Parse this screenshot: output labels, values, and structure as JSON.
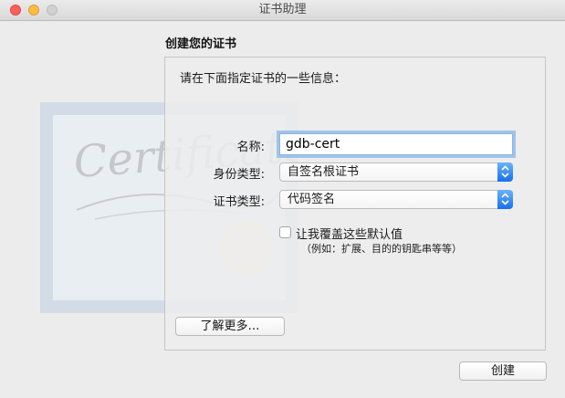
{
  "window": {
    "title": "证书助理"
  },
  "page": {
    "heading": "创建您的证书",
    "instruction": "请在下面指定证书的一些信息：",
    "artwork_text": "Certificate"
  },
  "form": {
    "name_label": "名称:",
    "name_value": "gdb-cert",
    "identity_type_label": "身份类型:",
    "identity_type_value": "自签名根证书",
    "cert_type_label": "证书类型:",
    "cert_type_value": "代码签名",
    "override_label": "让我覆盖这些默认值",
    "override_hint": "（例如：扩展、目的的钥匙串等等）",
    "override_checked": false
  },
  "buttons": {
    "learn_more": "了解更多…",
    "create": "创建"
  },
  "colors": {
    "popup_accent": "#1a73e8",
    "focus_ring": "#7fb0ec"
  }
}
